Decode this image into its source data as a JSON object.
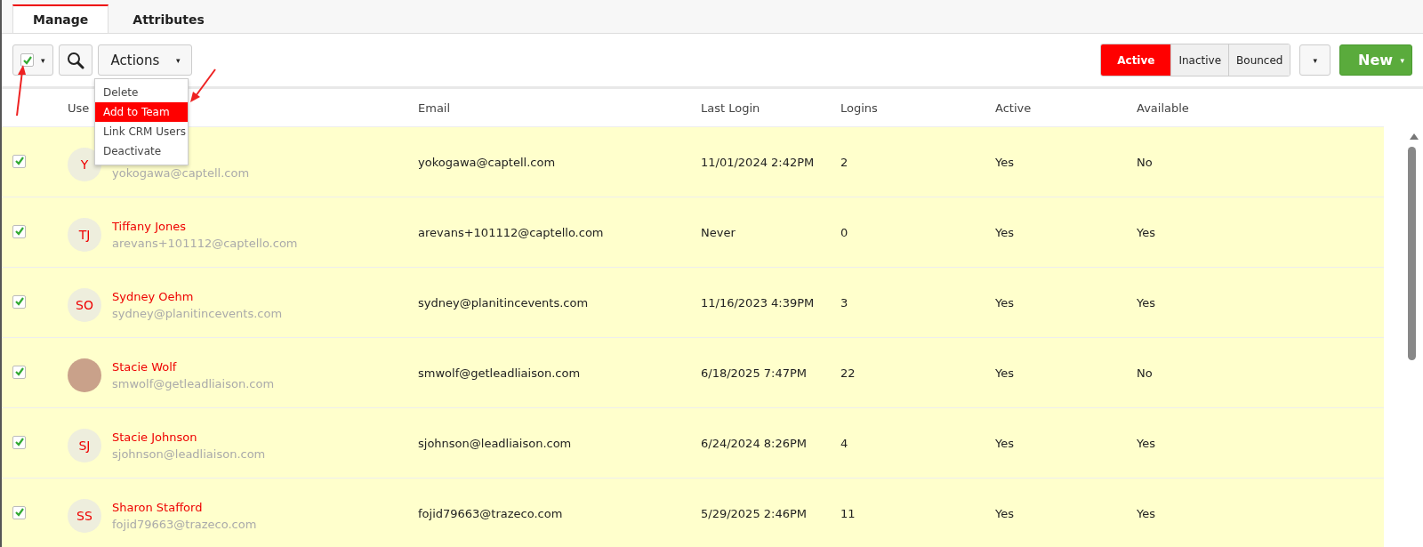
{
  "tabs": [
    {
      "label": "Manage",
      "selected": true
    },
    {
      "label": "Attributes",
      "selected": false
    }
  ],
  "toolbar": {
    "select_all": {
      "checked": true,
      "caret": "▾"
    },
    "actions": {
      "label": "Actions",
      "caret": "▾",
      "menu": [
        {
          "label": "Delete",
          "selected": false
        },
        {
          "label": "Add to Team",
          "selected": true
        },
        {
          "label": "Link CRM Users",
          "selected": false
        },
        {
          "label": "Deactivate",
          "selected": false
        }
      ]
    },
    "filters": [
      {
        "label": "Active",
        "selected": true
      },
      {
        "label": "Inactive",
        "selected": false
      },
      {
        "label": "Bounced",
        "selected": false
      }
    ],
    "filter_caret": "▾",
    "new_button": {
      "label": "New",
      "caret": "▾"
    }
  },
  "table": {
    "columns": [
      "Use",
      "Email",
      "Last Login",
      "Logins",
      "Active",
      "Available"
    ],
    "rows": [
      {
        "checked": true,
        "avatar": {
          "kind": "initials",
          "text": "Y"
        },
        "user_email": "yokogawa@captell.com",
        "email": "yokogawa@captell.com",
        "last_login": "11/01/2024 2:42PM",
        "logins": "2",
        "active": "Yes",
        "available": "No"
      },
      {
        "checked": true,
        "avatar": {
          "kind": "initials",
          "text": "TJ"
        },
        "name": "Tiffany Jones",
        "user_email": "arevans+101112@captello.com",
        "email": "arevans+101112@captello.com",
        "last_login": "Never",
        "logins": "0",
        "active": "Yes",
        "available": "Yes"
      },
      {
        "checked": true,
        "avatar": {
          "kind": "initials",
          "text": "SO"
        },
        "name": "Sydney Oehm",
        "user_email": "sydney@planitincevents.com",
        "email": "sydney@planitincevents.com",
        "last_login": "11/16/2023 4:39PM",
        "logins": "3",
        "active": "Yes",
        "available": "Yes"
      },
      {
        "checked": true,
        "avatar": {
          "kind": "photo"
        },
        "name": "Stacie Wolf",
        "user_email": "smwolf@getleadliaison.com",
        "email": "smwolf@getleadliaison.com",
        "last_login": "6/18/2025 7:47PM",
        "logins": "22",
        "active": "Yes",
        "available": "No"
      },
      {
        "checked": true,
        "avatar": {
          "kind": "initials",
          "text": "SJ"
        },
        "name": "Stacie Johnson",
        "user_email": "sjohnson@leadliaison.com",
        "email": "sjohnson@leadliaison.com",
        "last_login": "6/24/2024 8:26PM",
        "logins": "4",
        "active": "Yes",
        "available": "Yes"
      },
      {
        "checked": true,
        "avatar": {
          "kind": "initials",
          "text": "SS"
        },
        "name": "Sharon Stafford",
        "user_email": "fojid79663@trazeco.com",
        "email": "fojid79663@trazeco.com",
        "last_login": "5/29/2025 2:46PM",
        "logins": "11",
        "active": "Yes",
        "available": "Yes"
      }
    ]
  }
}
